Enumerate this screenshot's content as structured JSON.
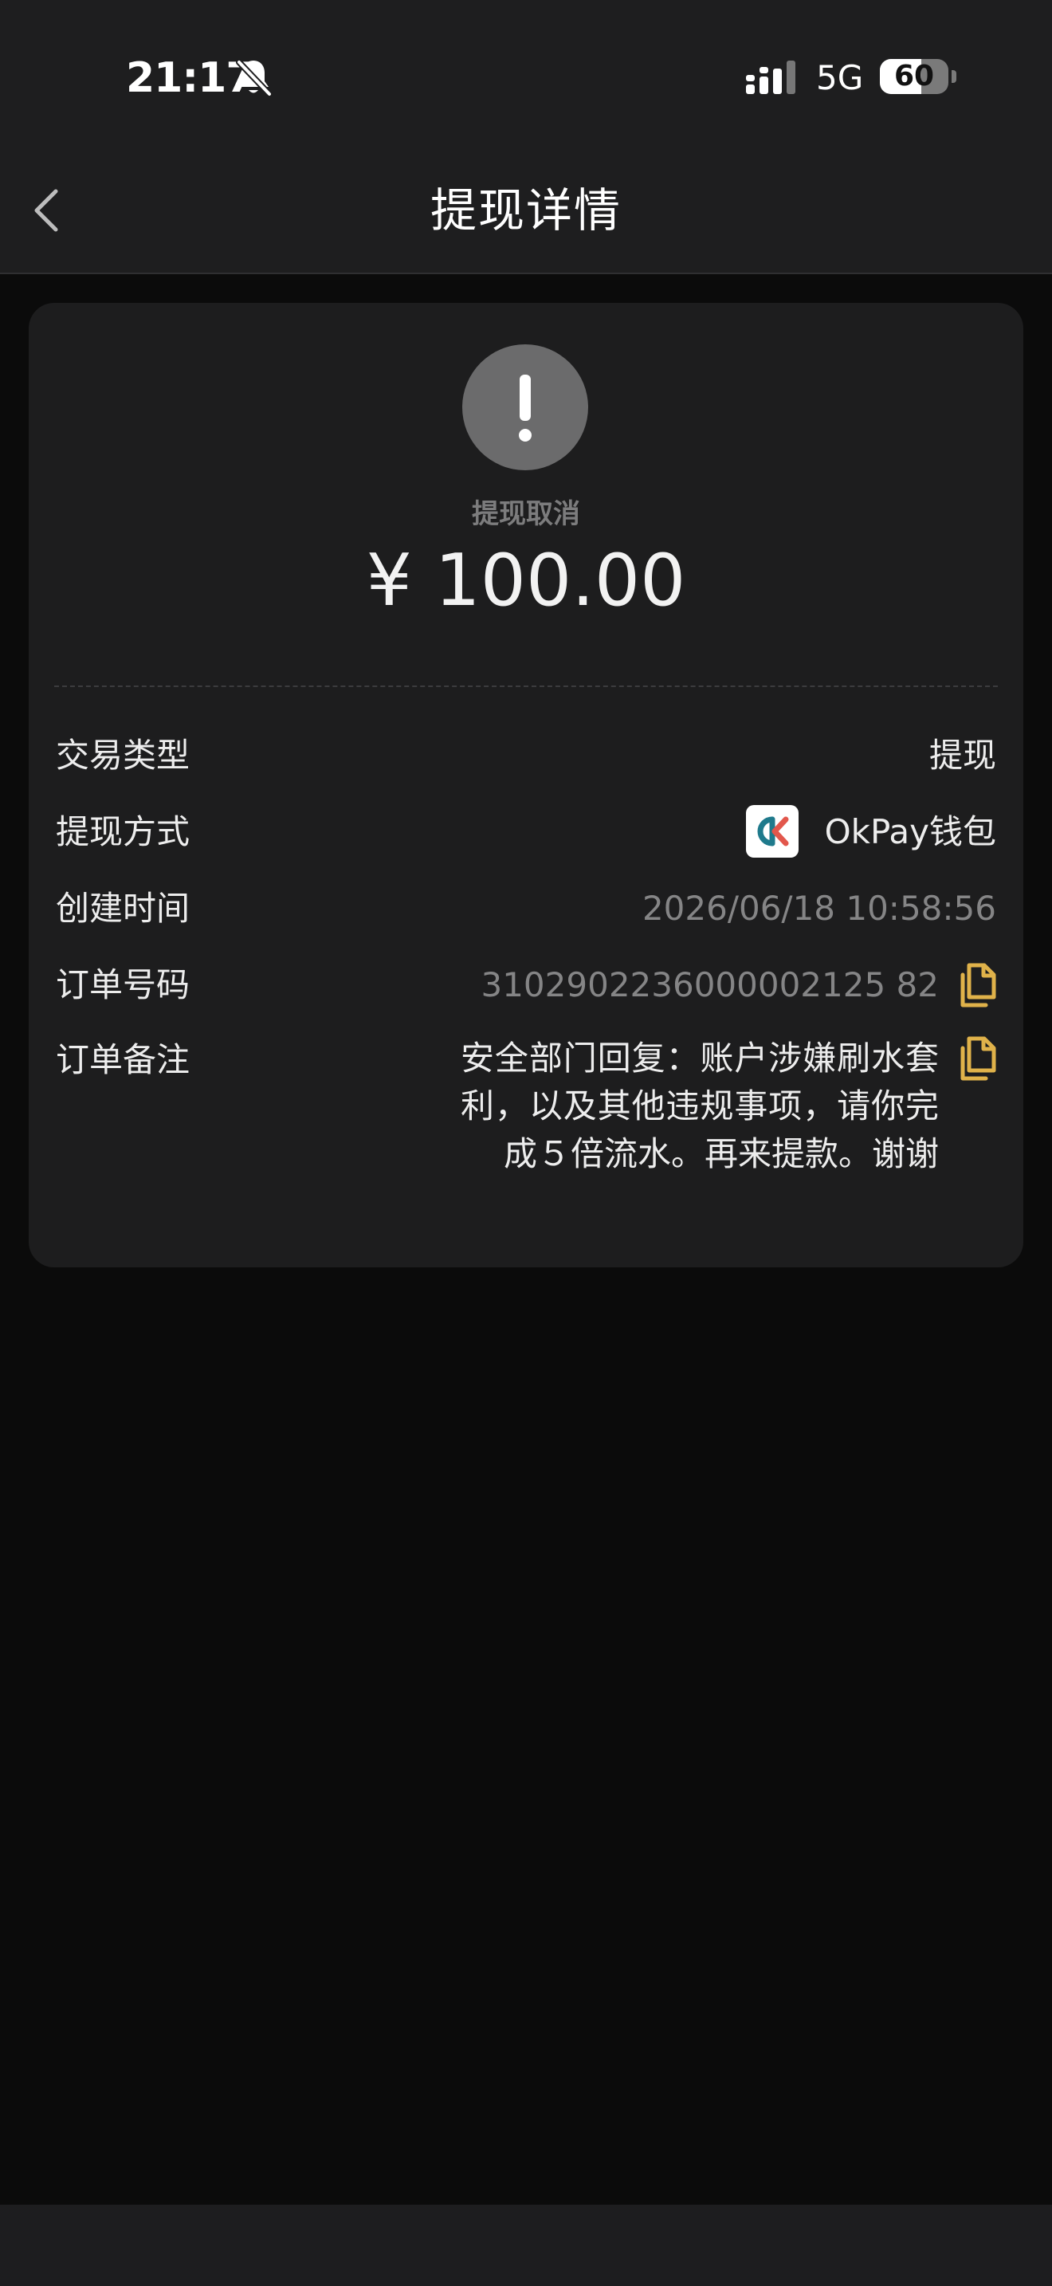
{
  "status_bar": {
    "time": "21:17",
    "network": "5G",
    "battery_level": "60",
    "battery_fraction": 0.6
  },
  "nav": {
    "title": "提现详情"
  },
  "summary": {
    "status_text": "提现取消",
    "amount": "¥ 100.00",
    "status_color": "#6b6b6c"
  },
  "details": {
    "type": {
      "label": "交易类型",
      "value": "提现"
    },
    "method": {
      "label": "提现方式",
      "value": "OkPay钱包",
      "logo_text": "OK"
    },
    "created": {
      "label": "创建时间",
      "value": "2026/06/18 10:58:56"
    },
    "order_no": {
      "label": "订单号码",
      "value": "3102902236000002125 82"
    },
    "remark": {
      "label": "订单备注",
      "value": "安全部门回复：账户涉嫌刷水套利，以及其他违规事项，请你完成５倍流水。再来提款。谢谢"
    }
  },
  "colors": {
    "accent": "#e0b24a",
    "card_bg": "#1d1d1e",
    "page_bg": "#0b0b0b"
  },
  "icons": [
    "back-chevron-icon",
    "bell-off-icon",
    "signal-icon",
    "alert-icon",
    "copy-icon",
    "okpay-logo"
  ]
}
